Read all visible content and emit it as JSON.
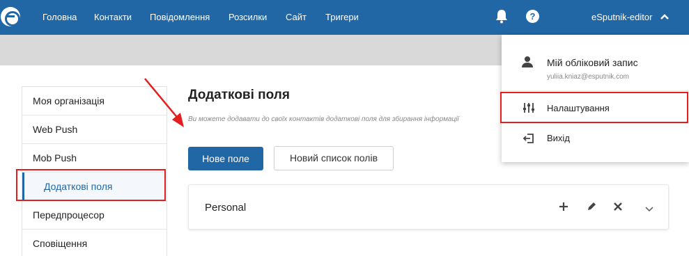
{
  "topnav": {
    "items": [
      "Головна",
      "Контакти",
      "Повідомлення",
      "Розсилки",
      "Сайт",
      "Тригери"
    ],
    "help_label": "?",
    "user_name": "eSputnik-editor"
  },
  "sidebar": {
    "items": [
      {
        "label": "Моя організація"
      },
      {
        "label": "Web Push"
      },
      {
        "label": "Mob Push"
      },
      {
        "label": "Додаткові поля"
      },
      {
        "label": "Передпроцесор"
      },
      {
        "label": "Сповіщення"
      }
    ],
    "active": "Додаткові поля"
  },
  "main": {
    "title": "Додаткові поля",
    "subtitle": "Ви можете додавати до своїх контактів додаткові поля для збирання інформації",
    "new_field_button": "Нове поле",
    "new_list_button": "Новий список полів",
    "card": {
      "title": "Personal",
      "actions": [
        "plus-icon",
        "pencil-icon",
        "close-icon",
        "chevron-down-icon"
      ]
    }
  },
  "dropdown": {
    "account_label": "Мій обліковий запис",
    "email": "yuliia.kniaz@esputnik.com",
    "settings_label": "Налаштування",
    "logout_label": "Вихід"
  },
  "colors": {
    "brand": "#2167a6",
    "highlight": "#e41e1e",
    "gray_strip": "#d9d9d9"
  }
}
